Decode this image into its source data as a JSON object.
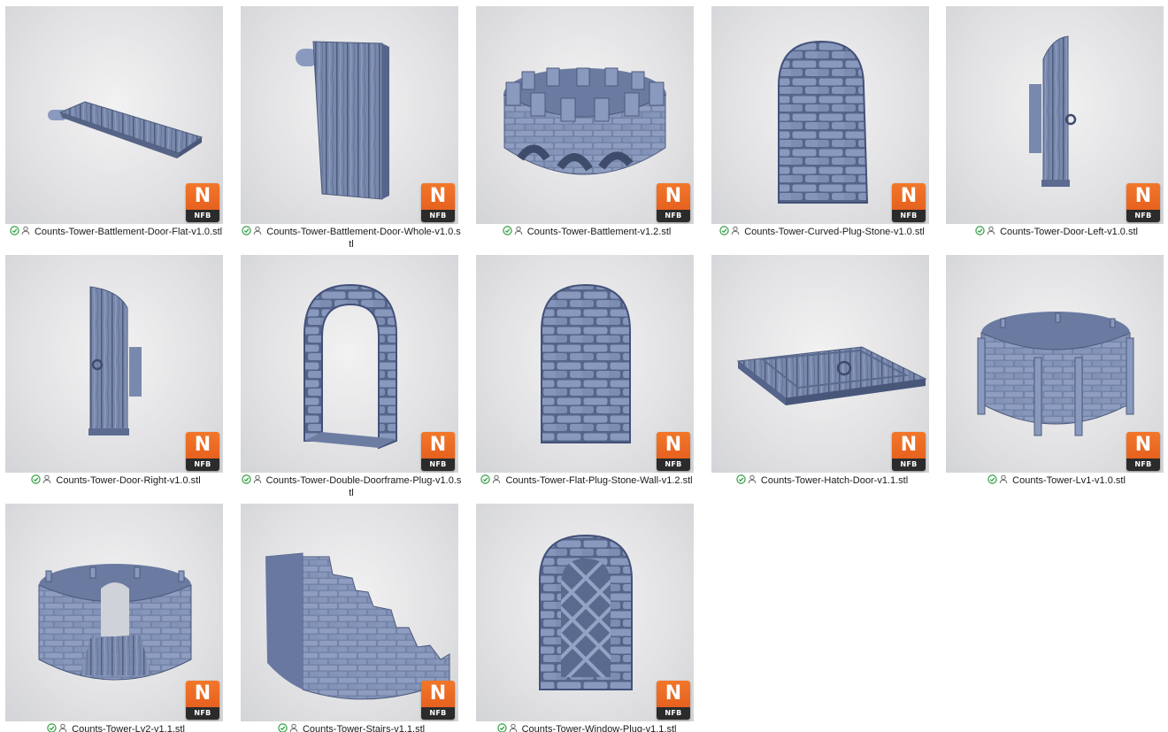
{
  "badge": {
    "letter": "N",
    "label": "NFB",
    "accent": "#e8641f"
  },
  "status_icons": {
    "synced": "green-check-circle-icon",
    "shared": "person-outline-icon",
    "synced_color": "#2e9e3e"
  },
  "files": [
    {
      "name": "Counts-Tower-Battlement-Door-Flat-v1.0.stl",
      "thumbnail": "wooden-plank-platform"
    },
    {
      "name": "Counts-Tower-Battlement-Door-Whole-v1.0.stl",
      "thumbnail": "wooden-plank-door"
    },
    {
      "name": "Counts-Tower-Battlement-v1.2.stl",
      "thumbnail": "round-crenellated-battlement"
    },
    {
      "name": "Counts-Tower-Curved-Plug-Stone-v1.0.stl",
      "thumbnail": "curved-stone-wall-plug"
    },
    {
      "name": "Counts-Tower-Door-Left-v1.0.stl",
      "thumbnail": "wooden-door-left"
    },
    {
      "name": "Counts-Tower-Door-Right-v1.0.stl",
      "thumbnail": "wooden-door-right"
    },
    {
      "name": "Counts-Tower-Double-Doorframe-Plug-v1.0.stl",
      "thumbnail": "stone-arched-doorframe"
    },
    {
      "name": "Counts-Tower-Flat-Plug-Stone-Wall-v1.2.stl",
      "thumbnail": "flat-stone-wall-plug"
    },
    {
      "name": "Counts-Tower-Hatch-Door-v1.1.stl",
      "thumbnail": "floor-hatch-door"
    },
    {
      "name": "Counts-Tower-Lv1-v1.0.stl",
      "thumbnail": "round-tower-level-1"
    },
    {
      "name": "Counts-Tower-Lv2-v1.1.stl",
      "thumbnail": "round-tower-level-2"
    },
    {
      "name": "Counts-Tower-Stairs-v1.1.stl",
      "thumbnail": "curved-stone-stairs"
    },
    {
      "name": "Counts-Tower-Window-Plug-v1.1.stl",
      "thumbnail": "arched-lattice-window"
    }
  ]
}
